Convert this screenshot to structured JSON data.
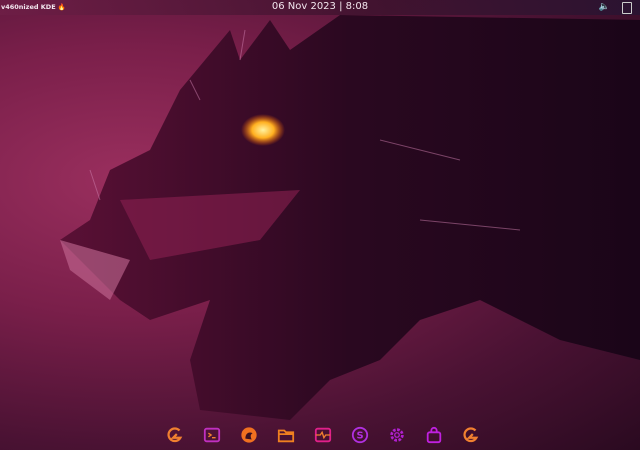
{
  "topbar": {
    "brand": "v460nized KDE",
    "date": "06 Nov 2023",
    "separator": "|",
    "time": "8:08"
  },
  "dock": {
    "items": [
      {
        "name": "launcher",
        "color": "#f08030"
      },
      {
        "name": "terminal",
        "color": "#c030c0"
      },
      {
        "name": "firefox",
        "color": "#f07020"
      },
      {
        "name": "files",
        "color": "#f08020"
      },
      {
        "name": "system-monitor",
        "color": "#e0208a"
      },
      {
        "name": "skype",
        "color": "#b030e0"
      },
      {
        "name": "settings",
        "color": "#b020d0"
      },
      {
        "name": "store",
        "color": "#c020e0"
      },
      {
        "name": "launcher-2",
        "color": "#f08030"
      }
    ]
  }
}
